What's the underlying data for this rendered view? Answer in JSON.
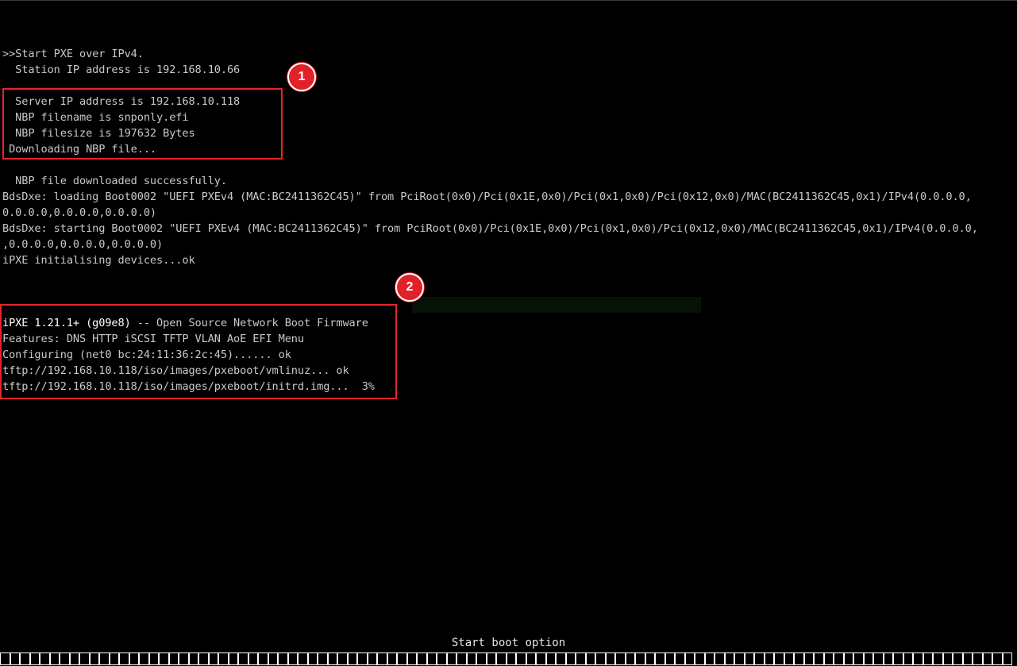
{
  "console": {
    "lines": [
      ">>Start PXE over IPv4.",
      "  Station IP address is 192.168.10.66",
      "  Server IP address is 192.168.10.118",
      "  NBP filename is snponly.efi",
      "  NBP filesize is 197632 Bytes",
      " Downloading NBP file...",
      "  NBP file downloaded successfully.",
      "BdsDxe: loading Boot0002 \"UEFI PXEv4 (MAC:BC2411362C45)\" from PciRoot(0x0)/Pci(0x1E,0x0)/Pci(0x1,0x0)/Pci(0x12,0x0)/MAC(BC2411362C45,0x1)/IPv4(0.0.0.0,",
      "0.0.0.0,0.0.0.0,0.0.0.0)",
      "BdsDxe: starting Boot0002 \"UEFI PXEv4 (MAC:BC2411362C45)\" from PciRoot(0x0)/Pci(0x1E,0x0)/Pci(0x1,0x0)/Pci(0x12,0x0)/MAC(BC2411362C45,0x1)/IPv4(0.0.0.0,",
      ",0.0.0.0,0.0.0.0,0.0.0.0)",
      "iPXE initialising devices...ok",
      "Features: DNS HTTP iSCSI TFTP VLAN AoE EFI Menu",
      "Configuring (net0 bc:24:11:36:2c:45)...... ok",
      "tftp://192.168.10.118/iso/images/pxeboot/vmlinuz... ok",
      "tftp://192.168.10.118/iso/images/pxeboot/initrd.img...  3%"
    ],
    "ipxe_version": "iPXE 1.21.1+ (g09e8)",
    "ipxe_tagline": " -- Open Source Network Boot Firmware"
  },
  "callouts": {
    "first": "1",
    "second": "2"
  },
  "footer": {
    "status": "Start boot option",
    "progress_fraction": 0.0
  },
  "colors": {
    "highlight": "#e8232b",
    "callout_fill": "#e0212a",
    "background": "#000000",
    "text": "#c9c9c9"
  }
}
